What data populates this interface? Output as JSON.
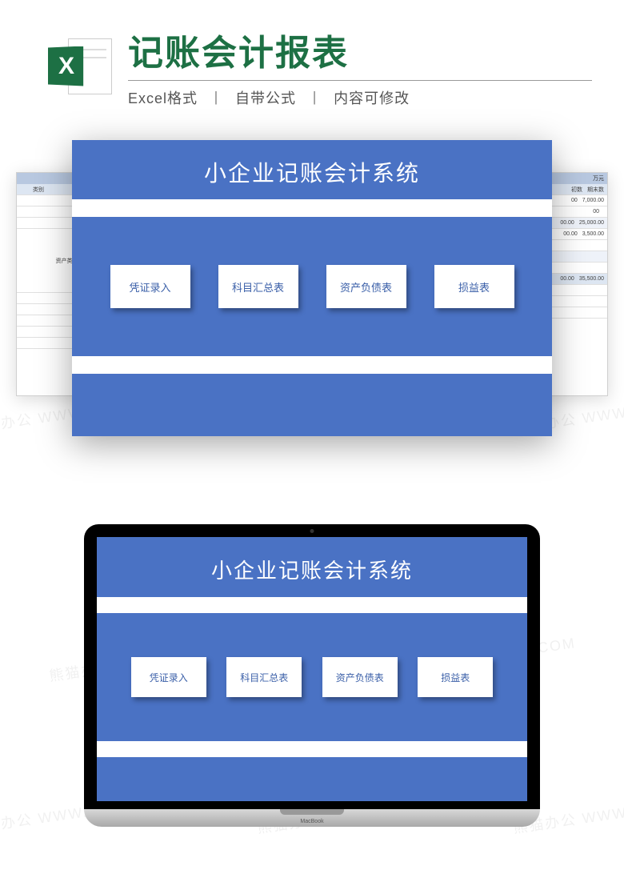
{
  "header": {
    "icon_letter": "X",
    "title": "记账会计报表",
    "sub_format": "Excel格式",
    "sub_formula": "自带公式",
    "sub_editable": "内容可修改"
  },
  "system": {
    "title": "小企业记账会计系统",
    "buttons": [
      "凭证录入",
      "科目汇总表",
      "资产负债表",
      "损益表"
    ]
  },
  "left_sheet": {
    "header": "类别",
    "side_label": "资产类"
  },
  "right_sheet": {
    "unit": "万元",
    "cols": [
      "初数",
      "期末数"
    ],
    "rows": [
      [
        "00",
        "7,000.00"
      ],
      [
        "00",
        ""
      ],
      [
        "00.00",
        "25,000.00"
      ],
      [
        "00.00",
        "3,500.00"
      ],
      [
        "",
        ""
      ],
      [
        "",
        ""
      ],
      [
        "00.00",
        "35,500.00"
      ]
    ]
  },
  "laptop": {
    "brand": "MacBook"
  },
  "watermark": "熊猫办公 WWW.TUKUPPT.COM"
}
